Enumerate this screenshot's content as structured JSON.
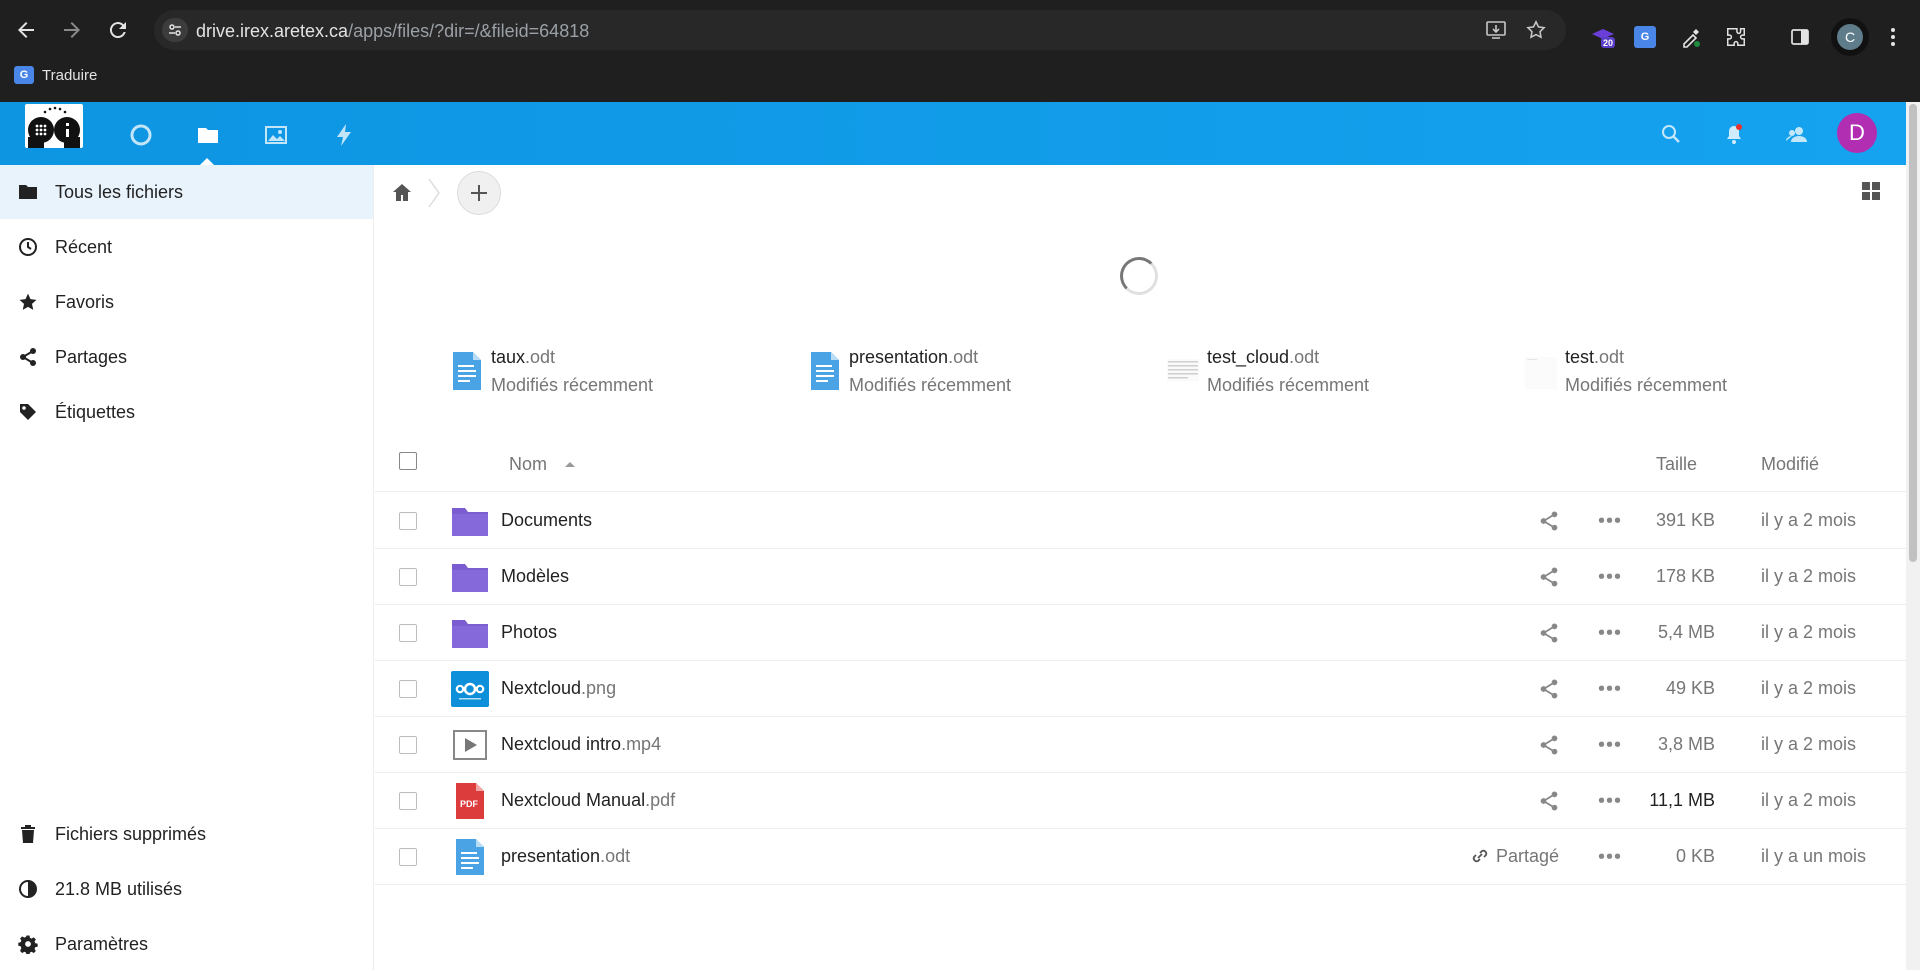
{
  "browser": {
    "url_host": "drive.irex.aretex.ca",
    "url_path": "/apps/files/?dir=/&fileid=64818",
    "extension_badge": "20",
    "profile_initial": "C",
    "bookmark_label": "Traduire"
  },
  "header": {
    "apps": [
      "dashboard-icon",
      "files-icon",
      "photos-icon",
      "activity-icon"
    ],
    "active_app": "files",
    "user_initial": "D",
    "avatar_color": "#b12eb2",
    "accent_color": "#0f9ce8"
  },
  "sidebar": {
    "items": [
      {
        "label": "Tous les fichiers",
        "icon": "folder-icon",
        "active": true
      },
      {
        "label": "Récent",
        "icon": "clock-icon"
      },
      {
        "label": "Favoris",
        "icon": "star-icon"
      },
      {
        "label": "Partages",
        "icon": "share-icon"
      },
      {
        "label": "Étiquettes",
        "icon": "tag-icon"
      }
    ],
    "bottom": [
      {
        "label": "Fichiers supprimés",
        "icon": "trash-icon"
      },
      {
        "label": "21.8 MB utilisés",
        "icon": "quota-pie-icon"
      },
      {
        "label": "Paramètres",
        "icon": "gear-icon"
      }
    ]
  },
  "recent": [
    {
      "base": "taux",
      "ext": ".odt",
      "sub": "Modifiés récemment"
    },
    {
      "base": "presentation",
      "ext": ".odt",
      "sub": "Modifiés récemment"
    },
    {
      "base": "test_cloud",
      "ext": ".odt",
      "sub": "Modifiés récemment"
    },
    {
      "base": "test",
      "ext": ".odt",
      "sub": "Modifiés récemment"
    }
  ],
  "list": {
    "col_name": "Nom",
    "col_size": "Taille",
    "col_modified": "Modifié",
    "rows": [
      {
        "base": "Documents",
        "ext": "",
        "type": "folder",
        "size": "391 KB",
        "modified": "il y a 2 mois"
      },
      {
        "base": "Modèles",
        "ext": "",
        "type": "folder",
        "size": "178 KB",
        "modified": "il y a 2 mois"
      },
      {
        "base": "Photos",
        "ext": "",
        "type": "folder",
        "size": "5,4 MB",
        "modified": "il y a 2 mois"
      },
      {
        "base": "Nextcloud",
        "ext": ".png",
        "type": "image",
        "size": "49 KB",
        "modified": "il y a 2 mois"
      },
      {
        "base": "Nextcloud intro",
        "ext": ".mp4",
        "type": "video",
        "size": "3,8 MB",
        "modified": "il y a 2 mois"
      },
      {
        "base": "Nextcloud Manual",
        "ext": ".pdf",
        "type": "pdf",
        "size": "11,1 MB",
        "modified": "il y a 2 mois"
      },
      {
        "base": "presentation",
        "ext": ".odt",
        "type": "document",
        "size": "0 KB",
        "modified": "il y a un mois",
        "shared_label": "Partagé"
      }
    ]
  }
}
